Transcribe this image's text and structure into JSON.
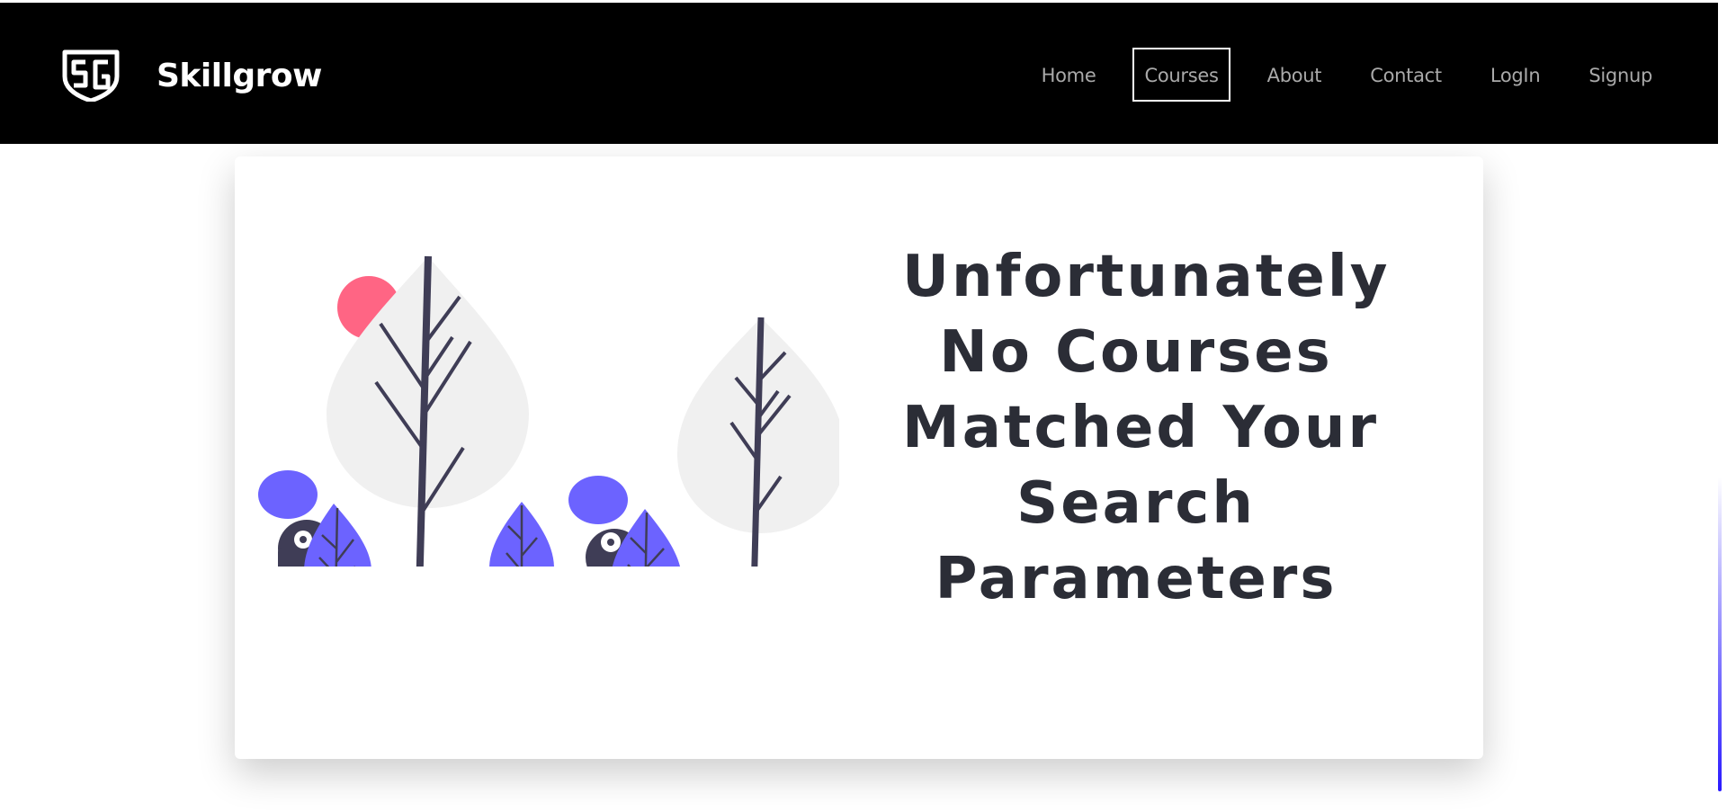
{
  "brand": {
    "name": "Skillgrow",
    "logo_icon": "skillgrow-shield-logo"
  },
  "nav": {
    "items": [
      {
        "label": "Home",
        "active": false
      },
      {
        "label": "Courses",
        "active": true
      },
      {
        "label": "About",
        "active": false
      },
      {
        "label": "Contact",
        "active": false
      },
      {
        "label": "LogIn",
        "active": false
      },
      {
        "label": "Signup",
        "active": false
      }
    ]
  },
  "empty_state": {
    "illustration": "trees-and-characters-illustration",
    "message_lines": [
      "Unfortunately",
      "No Courses",
      "Matched Your",
      "Search",
      "Parameters"
    ]
  },
  "colors": {
    "navbar_bg": "#000000",
    "nav_text": "#a9a9a9",
    "accent_purple": "#6c63ff",
    "accent_pink": "#ff6584",
    "dark_ink": "#3f3d56",
    "tree_fill": "#f0f0f0"
  }
}
